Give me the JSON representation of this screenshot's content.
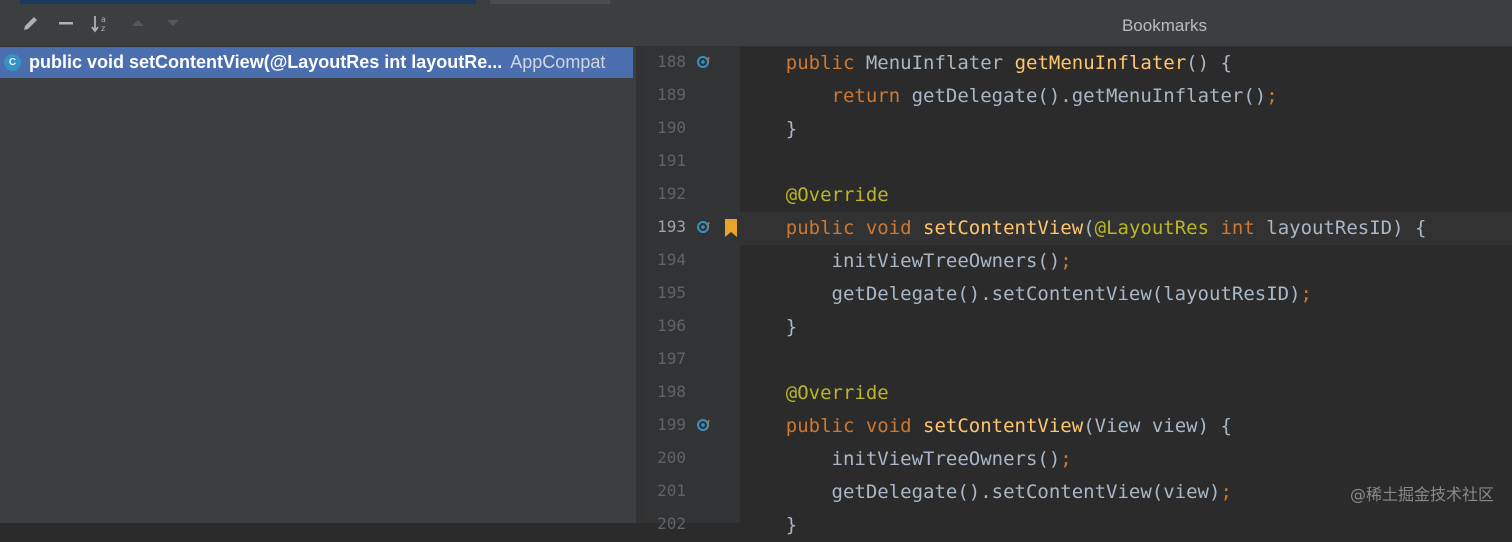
{
  "toolbar": {
    "icons": [
      "edit-icon",
      "collapse-icon",
      "sort-alpha-icon",
      "up-arrow-icon",
      "down-arrow-icon"
    ],
    "title": "Bookmarks"
  },
  "bookmark_list": {
    "items": [
      {
        "icon": "C",
        "signature": "public void setContentView(@LayoutRes int layoutRe...",
        "location": "AppCompat"
      }
    ]
  },
  "colors": {
    "selection": "#4b6eaf",
    "keyword": "#cc7832",
    "function": "#ffc66d",
    "annotation": "#bbb529",
    "text": "#a9b7c6",
    "bookmark": "#e8a32c",
    "override_marker": "#3592c4"
  },
  "editor": {
    "current_line": "193",
    "lines": [
      {
        "n": "188",
        "override": true,
        "bookmark": false,
        "tokens": [
          [
            "kw",
            "    public "
          ],
          [
            "tx",
            "MenuInflater "
          ],
          [
            "fn",
            "getMenuInflater"
          ],
          [
            "tx",
            "() {"
          ]
        ]
      },
      {
        "n": "189",
        "override": false,
        "bookmark": false,
        "tokens": [
          [
            "kw",
            "        return "
          ],
          [
            "tx",
            "getDelegate().getMenuInflater()"
          ],
          [
            "kw",
            ";"
          ]
        ]
      },
      {
        "n": "190",
        "override": false,
        "bookmark": false,
        "tokens": [
          [
            "tx",
            "    }"
          ]
        ]
      },
      {
        "n": "191",
        "override": false,
        "bookmark": false,
        "tokens": []
      },
      {
        "n": "192",
        "override": false,
        "bookmark": false,
        "tokens": [
          [
            "an",
            "    @Override"
          ]
        ]
      },
      {
        "n": "193",
        "override": true,
        "bookmark": true,
        "tokens": [
          [
            "kw",
            "    public void "
          ],
          [
            "fn",
            "setContentView"
          ],
          [
            "tx",
            "("
          ],
          [
            "an",
            "@LayoutRes "
          ],
          [
            "kw",
            "int "
          ],
          [
            "tx",
            "layoutResID) {"
          ]
        ]
      },
      {
        "n": "194",
        "override": false,
        "bookmark": false,
        "tokens": [
          [
            "tx",
            "        initViewTreeOwners()"
          ],
          [
            "kw",
            ";"
          ]
        ]
      },
      {
        "n": "195",
        "override": false,
        "bookmark": false,
        "tokens": [
          [
            "tx",
            "        getDelegate().setContentView(layoutResID)"
          ],
          [
            "kw",
            ";"
          ]
        ]
      },
      {
        "n": "196",
        "override": false,
        "bookmark": false,
        "tokens": [
          [
            "tx",
            "    }"
          ]
        ]
      },
      {
        "n": "197",
        "override": false,
        "bookmark": false,
        "tokens": []
      },
      {
        "n": "198",
        "override": false,
        "bookmark": false,
        "tokens": [
          [
            "an",
            "    @Override"
          ]
        ]
      },
      {
        "n": "199",
        "override": true,
        "bookmark": false,
        "tokens": [
          [
            "kw",
            "    public void "
          ],
          [
            "fn",
            "setContentView"
          ],
          [
            "tx",
            "(View view) {"
          ]
        ]
      },
      {
        "n": "200",
        "override": false,
        "bookmark": false,
        "tokens": [
          [
            "tx",
            "        initViewTreeOwners()"
          ],
          [
            "kw",
            ";"
          ]
        ]
      },
      {
        "n": "201",
        "override": false,
        "bookmark": false,
        "tokens": [
          [
            "tx",
            "        getDelegate().setContentView(view)"
          ],
          [
            "kw",
            ";"
          ]
        ]
      },
      {
        "n": "202",
        "override": false,
        "bookmark": false,
        "tokens": [
          [
            "tx",
            "    }"
          ]
        ]
      }
    ]
  },
  "watermark": "@稀土掘金技术社区"
}
